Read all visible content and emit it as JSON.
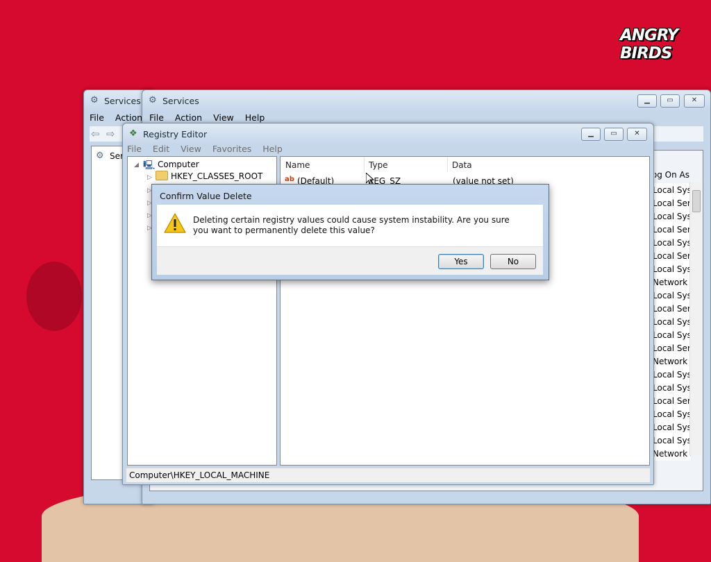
{
  "brand": {
    "logo_text": "ANGRY BIRDS"
  },
  "services_back": {
    "title": "Services",
    "menu": [
      "File",
      "Action"
    ],
    "tree_item": "Services (Local)"
  },
  "services_front": {
    "title": "Services",
    "menu": [
      "File",
      "Action",
      "View",
      "Help"
    ],
    "column_header": "Log On As",
    "log_on_as": [
      "Local Syste...",
      "Local Service",
      "Local Syste...",
      "Local Service",
      "Local Syste...",
      "Local Service",
      "Local Syste...",
      "Network S...",
      "Local Syste...",
      "Local Service",
      "Local Syste...",
      "Local Syste...",
      "Local Service",
      "Network S...",
      "Local Syste...",
      "Local Syste...",
      "Local Service",
      "Local Syste...",
      "Local Syste...",
      "Local Syste...",
      "Network S..."
    ]
  },
  "registry": {
    "title": "Registry Editor",
    "menu": [
      "File",
      "Edit",
      "View",
      "Favorites",
      "Help"
    ],
    "tree": {
      "root": "Computer",
      "hkey_classes_root": "HKEY_CLASSES_ROOT"
    },
    "columns": {
      "name": "Name",
      "type": "Type",
      "data": "Data"
    },
    "values": [
      {
        "name": "(Default)",
        "type": "REG_SZ",
        "data": "(value not set)"
      }
    ],
    "status": "Computer\\HKEY_LOCAL_MACHINE"
  },
  "dialog": {
    "title": "Confirm Value Delete",
    "message": "Deleting certain registry values could cause system instability. Are you sure you want to permanently delete this value?",
    "yes": "Yes",
    "no": "No"
  },
  "colors": {
    "background": "#d50a2e",
    "accent_beige": "#e4c4a6"
  },
  "icons": [
    "gear-icon",
    "back-arrow-icon",
    "forward-arrow-icon",
    "registry-icon",
    "computer-icon",
    "folder-icon",
    "string-value-icon",
    "warning-icon",
    "mouse-cursor-icon"
  ]
}
